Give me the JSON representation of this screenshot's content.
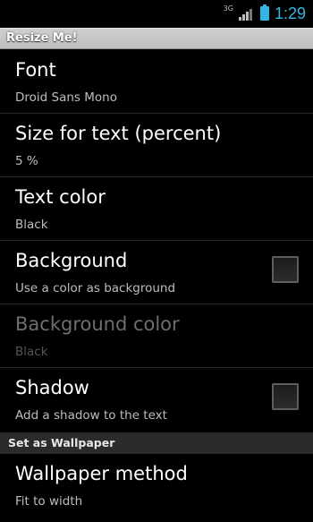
{
  "status_bar": {
    "network": "3G",
    "time": "1:29",
    "accent_color": "#33b5e5",
    "icons": [
      "signal-icon",
      "battery-icon"
    ]
  },
  "app": {
    "title": "Resize Me!"
  },
  "preferences": [
    {
      "title": "Font",
      "summary": "Droid Sans Mono"
    },
    {
      "title": "Size for text (percent)",
      "summary": "5 %"
    },
    {
      "title": "Text color",
      "summary": "Black"
    },
    {
      "title": "Background",
      "summary": "Use a color as background",
      "checked": false
    },
    {
      "title": "Background color",
      "summary": "Black",
      "enabled": false
    },
    {
      "title": "Shadow",
      "summary": "Add a shadow to the text",
      "checked": false
    }
  ],
  "category": {
    "label": "Set as Wallpaper"
  },
  "wallpaper": {
    "title": "Wallpaper method",
    "summary": "Fit to width"
  }
}
